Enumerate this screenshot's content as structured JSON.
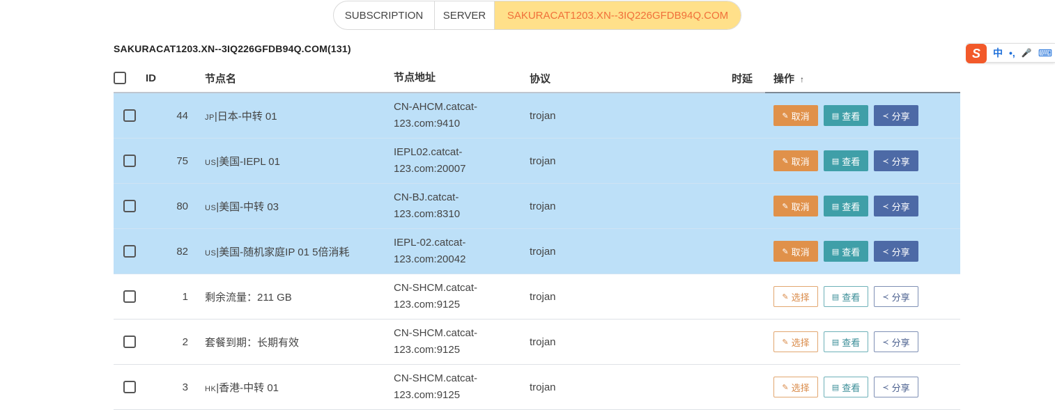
{
  "tabs": [
    {
      "label": "SUBSCRIPTION"
    },
    {
      "label": "SERVER"
    },
    {
      "label": "SAKURACAT1203.XN--3IQ226GFDB94Q.COM"
    }
  ],
  "group_title": "SAKURACAT1203.XN--3IQ226GFDB94Q.COM(131)",
  "ime": {
    "logo": "S",
    "mode": "中",
    "punct": "•,",
    "mic": "🎤",
    "keyboard": "⌨"
  },
  "table": {
    "headers": {
      "id": "ID",
      "name": "节点名",
      "address": "节点地址",
      "protocol": "协议",
      "latency": "时延",
      "actions": "操作",
      "sort": "↑"
    },
    "rows": [
      {
        "flag": "JP",
        "name": "|日本-中转 01",
        "id": "44",
        "addr1": "CN-AHCM.catcat-",
        "addr2": "123.com:9410",
        "protocol": "trojan",
        "selected": true,
        "a1": "取消",
        "a2": "查看",
        "a3": "分享"
      },
      {
        "flag": "US",
        "name": "|美国-IEPL 01",
        "id": "75",
        "addr1": "IEPL02.catcat-",
        "addr2": "123.com:20007",
        "protocol": "trojan",
        "selected": true,
        "a1": "取消",
        "a2": "查看",
        "a3": "分享"
      },
      {
        "flag": "US",
        "name": "|美国-中转 03",
        "id": "80",
        "addr1": "CN-BJ.catcat-",
        "addr2": "123.com:8310",
        "protocol": "trojan",
        "selected": true,
        "a1": "取消",
        "a2": "查看",
        "a3": "分享"
      },
      {
        "flag": "US",
        "name": "|美国-随机家庭IP 01 5倍消耗",
        "id": "82",
        "addr1": "IEPL-02.catcat-",
        "addr2": "123.com:20042",
        "protocol": "trojan",
        "selected": true,
        "a1": "取消",
        "a2": "查看",
        "a3": "分享"
      },
      {
        "flag": "",
        "name": "剩余流量：211 GB",
        "id": "1",
        "addr1": "CN-SHCM.catcat-",
        "addr2": "123.com:9125",
        "protocol": "trojan",
        "selected": false,
        "a1": "选择",
        "a2": "查看",
        "a3": "分享"
      },
      {
        "flag": "",
        "name": "套餐到期：长期有效",
        "id": "2",
        "addr1": "CN-SHCM.catcat-",
        "addr2": "123.com:9125",
        "protocol": "trojan",
        "selected": false,
        "a1": "选择",
        "a2": "查看",
        "a3": "分享"
      },
      {
        "flag": "HK",
        "name": "|香港-中转 01",
        "id": "3",
        "addr1": "CN-SHCM.catcat-",
        "addr2": "123.com:9125",
        "protocol": "trojan",
        "selected": false,
        "a1": "选择",
        "a2": "查看",
        "a3": "分享"
      }
    ]
  },
  "colors": {
    "accent_tab_bg": "#ffe08a",
    "accent_tab_text": "#f0703a",
    "selected_row": "#bde0f8",
    "cancel": "#e0914a",
    "view": "#3f9fa8",
    "share": "#4d6aa6"
  }
}
